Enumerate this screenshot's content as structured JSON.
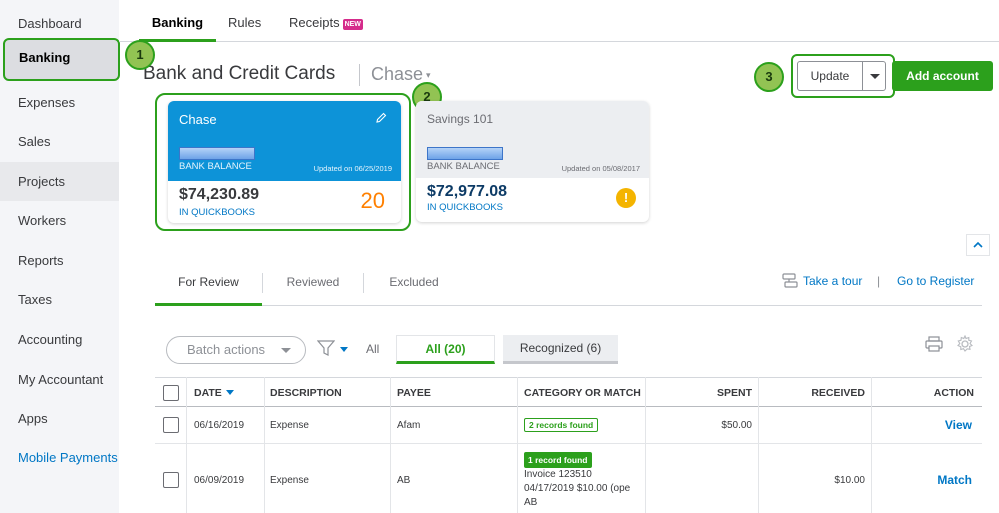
{
  "sidebar": {
    "items": [
      {
        "label": "Dashboard"
      },
      {
        "label": "Banking"
      },
      {
        "label": "Expenses"
      },
      {
        "label": "Sales"
      },
      {
        "label": "Projects"
      },
      {
        "label": "Workers"
      },
      {
        "label": "Reports"
      },
      {
        "label": "Taxes"
      },
      {
        "label": "Accounting"
      },
      {
        "label": "My Accountant"
      },
      {
        "label": "Apps"
      },
      {
        "label": "Mobile Payments"
      }
    ]
  },
  "topnav": {
    "tabs": [
      {
        "label": "Banking"
      },
      {
        "label": "Rules"
      },
      {
        "label": "Receipts",
        "badge": "NEW"
      }
    ]
  },
  "header": {
    "title": "Bank and Credit Cards",
    "account": "Chase",
    "update_label": "Update",
    "add_account_label": "Add account"
  },
  "callouts": [
    "1",
    "2",
    "3"
  ],
  "cards": [
    {
      "name": "Chase",
      "bank_balance_label": "BANK BALANCE",
      "updated": "Updated on 06/25/2019",
      "amount": "$74,230.89",
      "in_qb_label": "IN QUICKBOOKS",
      "review_count": "20"
    },
    {
      "name": "Savings 101",
      "bank_balance_label": "BANK BALANCE",
      "updated": "Updated on 05/08/2017",
      "amount": "$72,977.08",
      "in_qb_label": "IN QUICKBOOKS",
      "alert": "!"
    }
  ],
  "review_tabs": [
    {
      "label": "For Review"
    },
    {
      "label": "Reviewed"
    },
    {
      "label": "Excluded"
    }
  ],
  "links": {
    "tour": "Take a tour",
    "separator": "|",
    "register": "Go to Register"
  },
  "filters": {
    "batch_label": "Batch actions",
    "all_label": "All",
    "all_pill": "All (20)",
    "recognized_pill": "Recognized (6)"
  },
  "table": {
    "columns": [
      "DATE",
      "DESCRIPTION",
      "PAYEE",
      "CATEGORY OR MATCH",
      "SPENT",
      "RECEIVED",
      "ACTION"
    ],
    "rows": [
      {
        "date": "06/16/2019",
        "description": "Expense",
        "payee": "Afam",
        "category_badge": "2 records found",
        "spent": "$50.00",
        "received": "",
        "action": "View"
      },
      {
        "date": "06/09/2019",
        "description": "Expense",
        "payee": "AB",
        "category_badge": "1 record found",
        "category_line1": "Invoice 123510",
        "category_line2": "04/17/2019 $10.00 (ope",
        "category_line3": "AB",
        "spent": "",
        "received": "$10.00",
        "action": "Match"
      }
    ]
  },
  "colors": {
    "accent_green": "#2ca01c",
    "link_blue": "#0077c5",
    "chase_card": "#0d93d8",
    "callout_fill": "#92c353",
    "alert_yellow": "#f4b400",
    "review_count_orange": "#ff8000"
  }
}
